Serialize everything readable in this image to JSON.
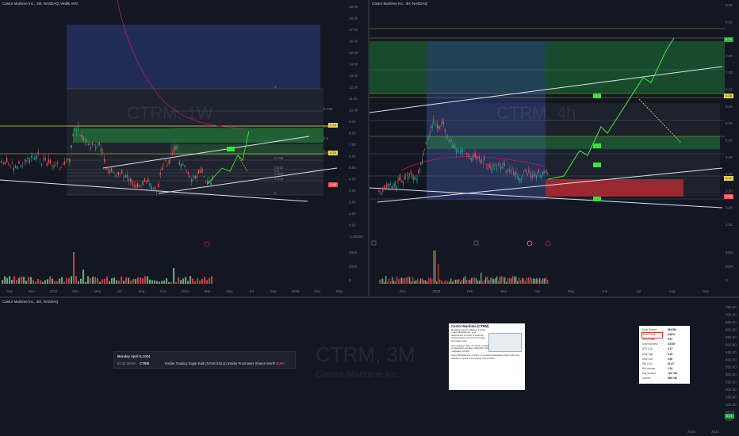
{
  "panes": {
    "top_left": {
      "header": "Castor Maritime Inc., 1W, NASDAQ, Vedlik AVG",
      "watermark": "CTRM, 1W",
      "price_labels": [
        "19.00",
        "18.00",
        "17.00",
        "16.00",
        "15.00",
        "14.00",
        "13.00",
        "12.00",
        "11.00",
        "10.00",
        "9.00",
        "8.00",
        "7.00",
        "6.00",
        "5.00",
        "4.00",
        "3.00",
        "2.00",
        "1.00",
        "0.00",
        "-1.00000"
      ],
      "tag_current": "7.74",
      "tag_mid": "4.20",
      "tag_bottom": "2.48",
      "vol_labels": [
        "400K",
        "200K",
        "0"
      ],
      "time_labels": [
        "Sep",
        "Nov",
        "2022",
        "Mar",
        "May",
        "Jul",
        "Sep",
        "Nov",
        "2024",
        "Mar",
        "May",
        "Jul",
        "Sep",
        "2025",
        "Mar",
        "May"
      ],
      "fib_labels": [
        "1",
        "0.786",
        "0.618",
        "0.5",
        "0.382",
        "0.236",
        "0"
      ],
      "fib_labels_right": [
        "0.786",
        "0.618",
        "0.5",
        "0.382"
      ]
    },
    "top_right": {
      "header": "Castor Maritime Inc., 4H, NASDAQ",
      "watermark": "CTRM, 4h",
      "price_labels": [
        "9.00",
        "8.50",
        "8.00",
        "7.50",
        "7.00",
        "6.50",
        "6.00",
        "5.50",
        "5.00",
        "4.50",
        "4.00",
        "3.50",
        "3.00",
        "2.50"
      ],
      "tag_top": "8.70",
      "tag_mid": "6.38",
      "tag_low1": "3.71",
      "tag_low2": "2.49",
      "vol_labels": [
        "400K",
        "200K",
        "0"
      ],
      "time_labels": [
        "Dec",
        "2024",
        "Feb",
        "Mar",
        "Apr",
        "May",
        "Jun",
        "Jul",
        "Aug",
        "Sep"
      ]
    },
    "bottom": {
      "header": "Castor Maritime Inc., 3M, NASDAQ",
      "watermark_main": "CTRM, 3M",
      "watermark_sub": "Castor Maritime Inc.",
      "price_labels": [
        "750.00",
        "700.00",
        "650.00",
        "600.00",
        "550.00",
        "500.00",
        "450.00",
        "400.00",
        "350.00",
        "300.00",
        "250.00",
        "200.00",
        "150.00",
        "100.00",
        "50.00",
        "0.00"
      ],
      "tag_bottom": "3.71",
      "time_labels": [
        "2019",
        "2022"
      ]
    }
  },
  "news": {
    "date": "Monday April 8, 2024",
    "time": "01:42:20AM",
    "ticker": "CTRM",
    "headline": "Insider Trading: Eagle Bulk (NYSE:EGLE) Insider Purchases Shares Worth",
    "amount": "$19M"
  },
  "info_card": {
    "title": "Castor Maritime (CTRM)",
    "paragraphs": [
      "Headquartered in Limassol, Cyprus, Castor Maritime Inc. is an international provider of seaborne transportation services for dry bulk and tanker cargo.",
      "The company's fleet of vessels, consisting of dry bulk carriers and tankers, is chartered to leading commodity traders, operators, and shipping companies globally.",
      "Castor Maritime has a history of sporadic momentum-driven rallies and remains a popular ticker among active traders."
    ]
  },
  "stats": {
    "rows": [
      {
        "k": "Float Shares",
        "v": "96.62M"
      },
      {
        "k": "Short Float",
        "v": "8.35%"
      },
      {
        "k": "Short Ratio",
        "v": "0.97"
      },
      {
        "k": "Short Interest",
        "v": "8.07M"
      },
      {
        "k": "ATR (14)",
        "v": "0.17"
      },
      {
        "k": "52W High",
        "v": "5.43"
      },
      {
        "k": "52W Low",
        "v": "2.06"
      },
      {
        "k": "RSI (14)",
        "v": "61.47"
      },
      {
        "k": "Rel Volume",
        "v": "1.34"
      },
      {
        "k": "Avg Volume",
        "v": "744.79K"
      },
      {
        "k": "Volume",
        "v": "998.74K"
      }
    ]
  },
  "colors": {
    "up": "#26a69a",
    "down": "#ef5350",
    "green_zone": "#22ab3f",
    "blue_zone": "#2a3a7a",
    "red_zone": "#b22833",
    "yellow": "#e8d64a",
    "proj": "#3ce03c",
    "magenta": "#c2185b"
  }
}
